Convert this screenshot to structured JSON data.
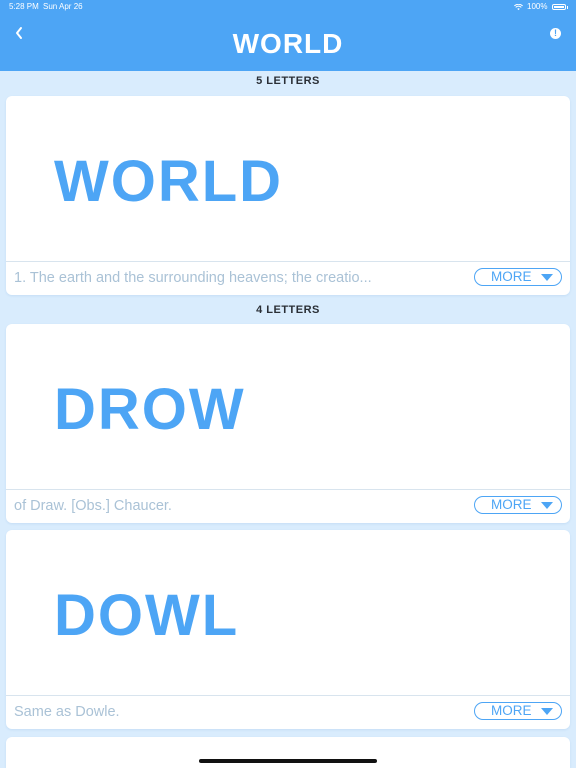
{
  "status": {
    "time": "5:28 PM",
    "date": "Sun Apr 26",
    "battery": "100%"
  },
  "header": {
    "title": "WORLD"
  },
  "sections": [
    {
      "label": "5 LETTERS"
    },
    {
      "label": "4 LETTERS"
    }
  ],
  "cards": [
    {
      "word": "WORLD",
      "definition": "1. The earth and the surrounding heavens; the creatio...",
      "more_label": "MORE"
    },
    {
      "word": "DROW",
      "definition": "of Draw. [Obs.] Chaucer.",
      "more_label": "MORE"
    },
    {
      "word": "DOWL",
      "definition": "Same as Dowle.",
      "more_label": "MORE"
    }
  ],
  "colors": {
    "accent": "#4da5f5",
    "background": "#d9ecfd"
  }
}
